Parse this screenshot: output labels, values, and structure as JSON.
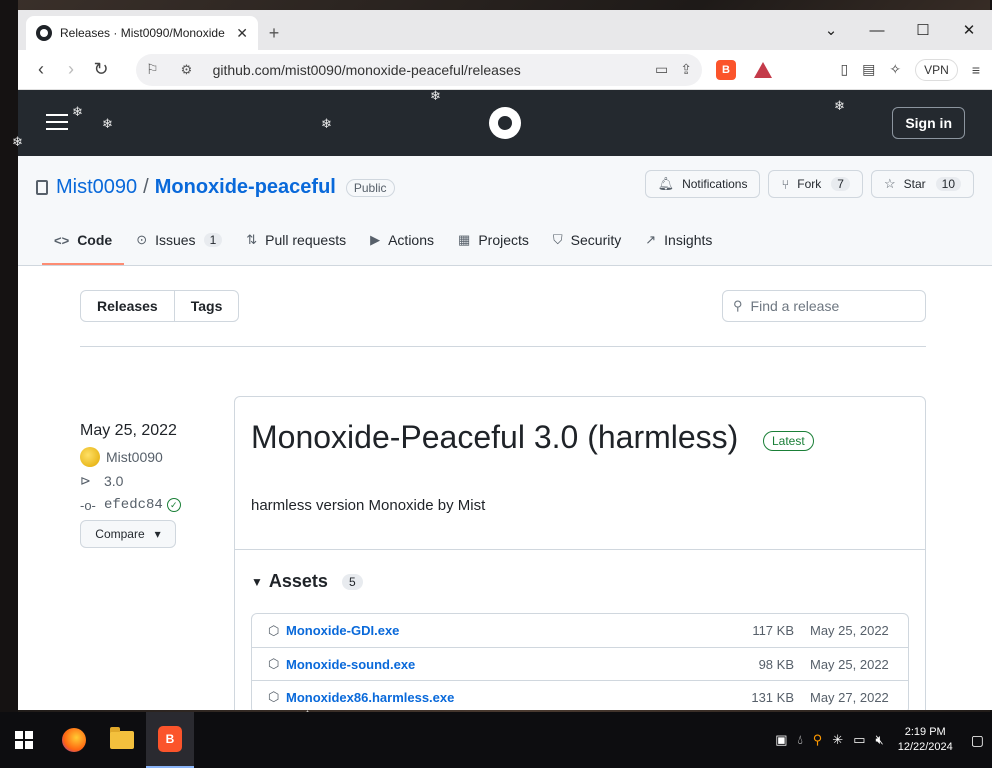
{
  "browser": {
    "tab_title": "Releases · Mist0090/Monoxide",
    "tab_close": "✕",
    "new_tab": "+",
    "url": "github.com/mist0090/monoxide-peaceful/releases",
    "vpn_label": "VPN",
    "window_controls": {
      "minimize": "—",
      "maximize": "☐",
      "close": "✕"
    }
  },
  "github": {
    "sign_in": "Sign in",
    "owner": "Mist0090",
    "slash": "/",
    "repo": "Monoxide-peaceful",
    "visibility": "Public",
    "actions": {
      "notifications": "Notifications",
      "fork": "Fork",
      "fork_count": "7",
      "star": "Star",
      "star_count": "10"
    },
    "tabs": [
      {
        "label": "Code",
        "icon": "<>"
      },
      {
        "label": "Issues",
        "icon": "⊙",
        "count": "1"
      },
      {
        "label": "Pull requests",
        "icon": "⇅"
      },
      {
        "label": "Actions",
        "icon": "▶"
      },
      {
        "label": "Projects",
        "icon": "▦"
      },
      {
        "label": "Security",
        "icon": "⛉"
      },
      {
        "label": "Insights",
        "icon": "↗"
      }
    ]
  },
  "releases": {
    "segments": [
      "Releases",
      "Tags"
    ],
    "search_placeholder": "Find a release",
    "release": {
      "date": "May 25, 2022",
      "author": "Mist0090",
      "tag": "3.0",
      "commit": "efedc84",
      "compare": "Compare",
      "title": "Monoxide-Peaceful 3.0 (harmless)",
      "badge": "Latest",
      "description": "harmless version Monoxide by Mist",
      "assets_label": "Assets",
      "assets_count": "5",
      "assets": [
        {
          "name": "Monoxide-GDI.exe",
          "size": "117 KB",
          "date": "May 25, 2022"
        },
        {
          "name": "Monoxide-sound.exe",
          "size": "98 KB",
          "date": "May 25, 2022"
        },
        {
          "name": "Monoxidex86.harmless.exe",
          "size": "131 KB",
          "date": "May 27, 2022"
        }
      ]
    }
  },
  "taskbar": {
    "time": "2:19 PM",
    "date": "12/22/2024"
  },
  "colors": {
    "link": "#0969da",
    "header": "#24292f",
    "active_tab_underline": "#fd8c73",
    "latest_green": "#1a7f37"
  }
}
